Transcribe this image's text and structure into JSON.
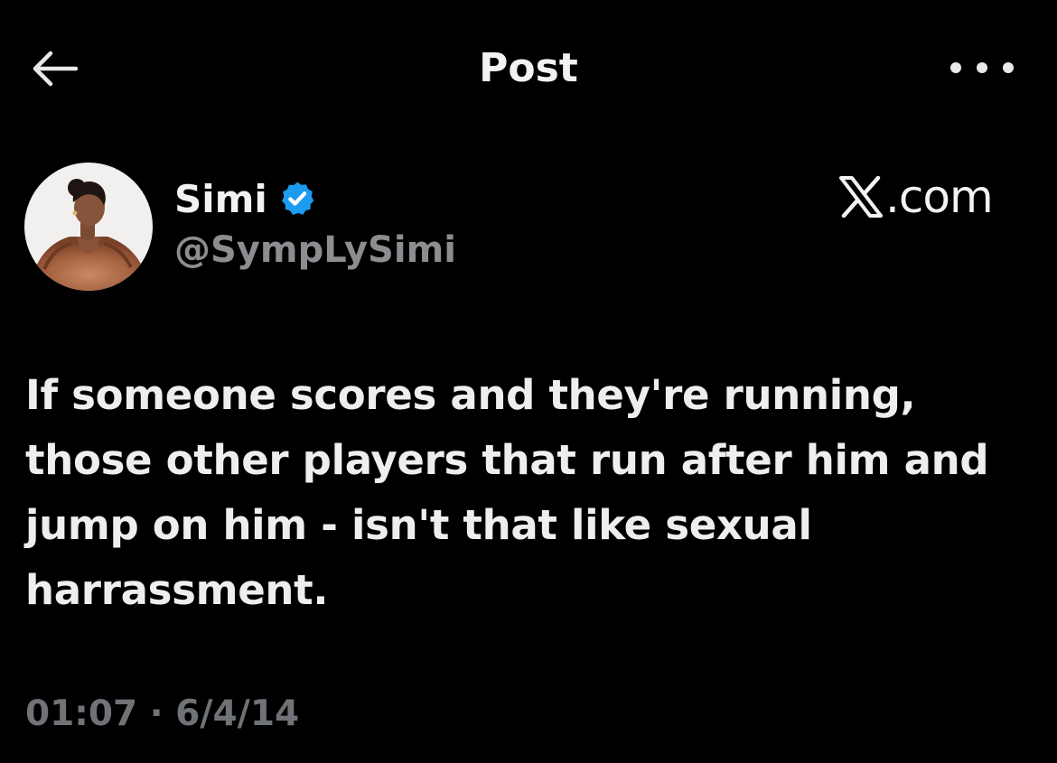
{
  "header": {
    "title": "Post",
    "back_icon": "arrow-left-icon",
    "more_icon": "more-horizontal-icon"
  },
  "author": {
    "display_name": "Simi",
    "handle": "@SympLySimi",
    "verified_icon": "verified-badge-icon",
    "verified_color": "#1d9bf0"
  },
  "watermark": {
    "text": ".com"
  },
  "post": {
    "text": "If someone scores and they're running, those other players that run after him and jump on him - isn't that like sexual harrassment.",
    "time": "01:07",
    "separator": "·",
    "date": "6/4/14"
  },
  "colors": {
    "background": "#000000",
    "text_primary": "#e7e9ea",
    "text_secondary": "#8b8d90",
    "timestamp": "#6f7276",
    "accent": "#1d9bf0"
  }
}
